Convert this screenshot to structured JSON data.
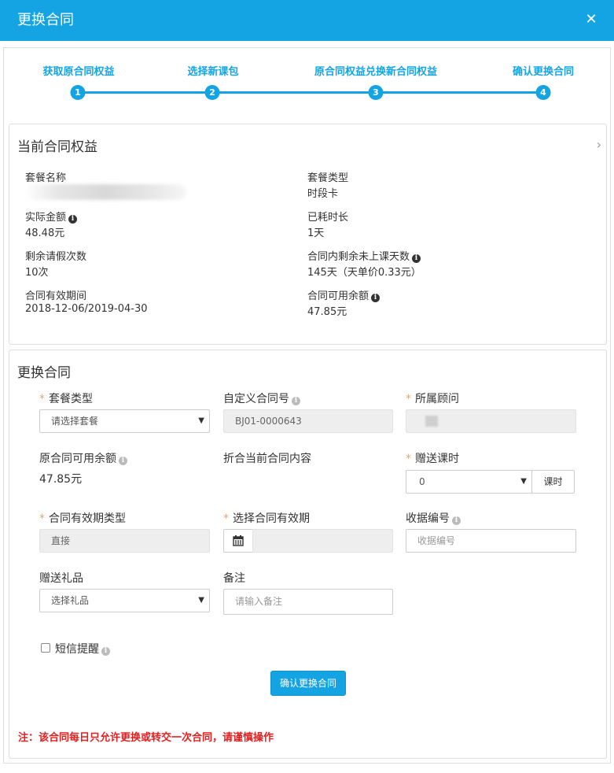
{
  "modal": {
    "title": "更换合同",
    "close_icon": "close-icon"
  },
  "steps": [
    {
      "label": "获取原合同权益",
      "num": "1"
    },
    {
      "label": "选择新课包",
      "num": "2"
    },
    {
      "label": "原合同权益兑换新合同权益",
      "num": "3"
    },
    {
      "label": "确认更换合同",
      "num": "4"
    }
  ],
  "current": {
    "title": "当前合同权益",
    "package_name_label": "套餐名称",
    "package_type_label": "套餐类型",
    "package_type_value": "时段卡",
    "amount_label": "实际金额",
    "amount_value": "48.48元",
    "used_label": "已耗时长",
    "used_value": "1天",
    "leave_label": "剩余请假次数",
    "leave_value": "10次",
    "remain_days_label": "合同内剩余未上课天数",
    "remain_days_value": "145天（天单价0.33元）",
    "period_label": "合同有效期间",
    "period_value": "2018-12-06/2019-04-30",
    "balance_label": "合同可用余额",
    "balance_value": "47.85元"
  },
  "form": {
    "title": "更换合同",
    "package_type_label": "套餐类型",
    "package_type_value": "请选择套餐",
    "custom_no_label": "自定义合同号",
    "custom_no_value": "BJ01-0000643",
    "advisor_label": "所属顾问",
    "orig_balance_label": "原合同可用余额",
    "orig_balance_value": "47.85元",
    "discount_label": "折合当前合同内容",
    "gift_hours_label": "赠送课时",
    "gift_hours_value": "0",
    "gift_hours_unit": "课时",
    "validity_type_label": "合同有效期类型",
    "validity_type_value": "直接",
    "validity_label": "选择合同有效期",
    "receipt_label": "收据编号",
    "receipt_placeholder": "收据编号",
    "gift_label": "赠送礼品",
    "gift_value": "选择礼品",
    "remark_label": "备注",
    "remark_placeholder": "请输入备注",
    "sms_label": "短信提醒",
    "confirm_label": "确认更换合同"
  },
  "warning": "注：该合同每日只允许更换或转交一次合同，请谨慎操作",
  "colors": {
    "accent": "#15a4e3",
    "required": "#f0a45a",
    "warning": "#e02020"
  }
}
